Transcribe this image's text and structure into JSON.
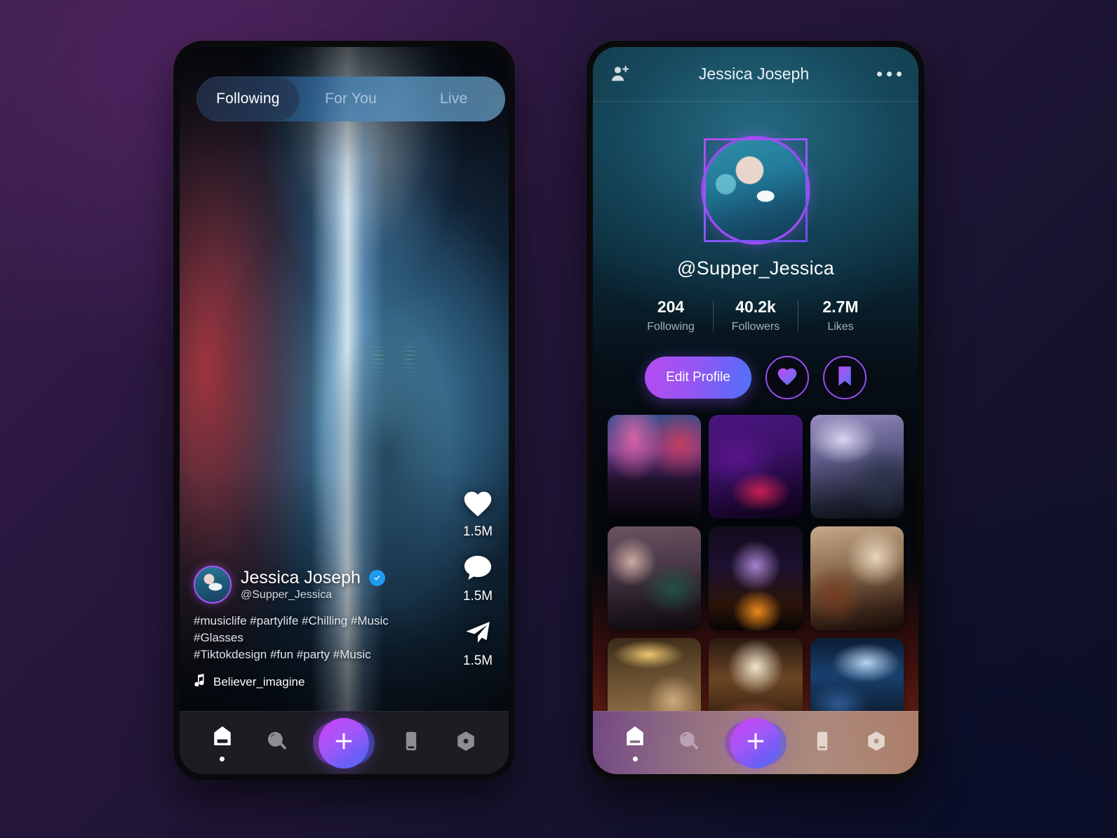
{
  "feed": {
    "tabs": [
      {
        "label": "Following",
        "active": true
      },
      {
        "label": "For You",
        "active": false
      },
      {
        "label": "Live",
        "active": false
      }
    ],
    "post": {
      "author_name": "Jessica Joseph",
      "author_handle": "@Supper_Jessica",
      "verified": true,
      "hashtags_line1": "#musiclife #partylife #Chilling #Music #Glasses",
      "hashtags_line2": "#Tiktokdesign #fun #party #Music",
      "music_title": "Believer_imagine"
    },
    "actions": [
      {
        "icon": "heart-icon",
        "count": "1.5M"
      },
      {
        "icon": "comment-icon",
        "count": "1.5M"
      },
      {
        "icon": "share-icon",
        "count": "1.5M"
      }
    ]
  },
  "profile": {
    "header": {
      "title": "Jessica Joseph",
      "add_user_icon": "add-user-icon",
      "more_icon": "more-options-icon"
    },
    "handle": "@Supper_Jessica",
    "stats": [
      {
        "value": "204",
        "label": "Following"
      },
      {
        "value": "40.2k",
        "label": "Followers"
      },
      {
        "value": "2.7M",
        "label": "Likes"
      }
    ],
    "edit_label": "Edit Profile",
    "like_icon": "heart-icon",
    "save_icon": "bookmark-icon",
    "grid_tiles": [
      "concert-crowd-stage",
      "dj-mixing-deck",
      "club-smoke-crowd",
      "friends-toasting-drinks",
      "fireworks-celebration",
      "wine-glasses-cheers",
      "party-string-lights-dinner",
      "concert-hands-heart",
      "confetti-crowd-stage"
    ]
  },
  "bottom_nav": {
    "items": [
      {
        "icon": "home-icon",
        "active": true
      },
      {
        "icon": "search-icon",
        "active": false
      },
      {
        "icon": "add-icon",
        "active": false
      },
      {
        "icon": "inbox-icon",
        "active": false
      },
      {
        "icon": "profile-icon",
        "active": false
      }
    ]
  },
  "colors": {
    "accent_purple": "#9a4df0",
    "accent_blue": "#4f73f8",
    "verified_blue": "#1d9bf0",
    "bg_start": "#3c1f4d",
    "bg_end": "#0d0f26"
  }
}
